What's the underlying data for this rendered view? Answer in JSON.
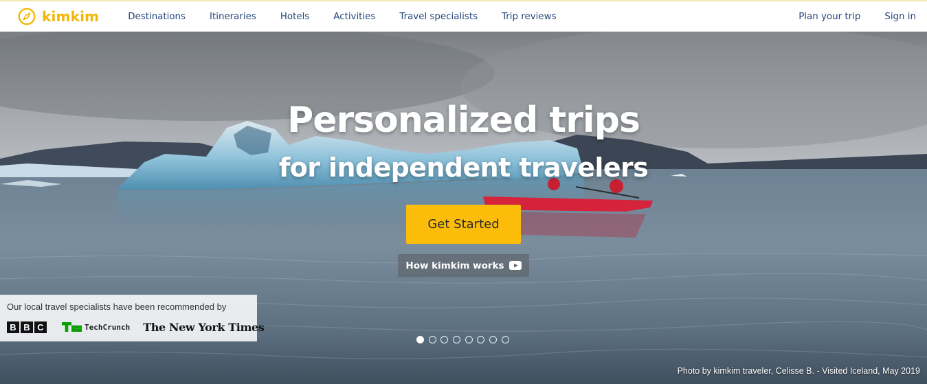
{
  "brand": {
    "name": "kimkim",
    "color": "#f2b705"
  },
  "nav": {
    "links": [
      {
        "label": "Destinations"
      },
      {
        "label": "Itineraries"
      },
      {
        "label": "Hotels"
      },
      {
        "label": "Activities"
      },
      {
        "label": "Travel specialists"
      },
      {
        "label": "Trip reviews"
      }
    ],
    "plan_trip": "Plan your trip",
    "sign_in": "Sign in",
    "link_color": "#24467a"
  },
  "hero": {
    "title_line1": "Personalized trips",
    "title_line2": "for independent travelers",
    "cta_label": "Get Started",
    "cta_color": "#fbbd0a",
    "how_label": "How kimkim works",
    "how_icon": "youtube-play-icon",
    "photo_credit": "Photo by kimkim traveler, Celisse B. - Visited Iceland, May 2019"
  },
  "press": {
    "intro": "Our local travel specialists have been recommended by",
    "bbc_letters": [
      "B",
      "B",
      "C"
    ],
    "techcrunch": "TechCrunch",
    "nyt": "The New York Times"
  },
  "carousel": {
    "slide_count": 8,
    "active_index": 0
  }
}
